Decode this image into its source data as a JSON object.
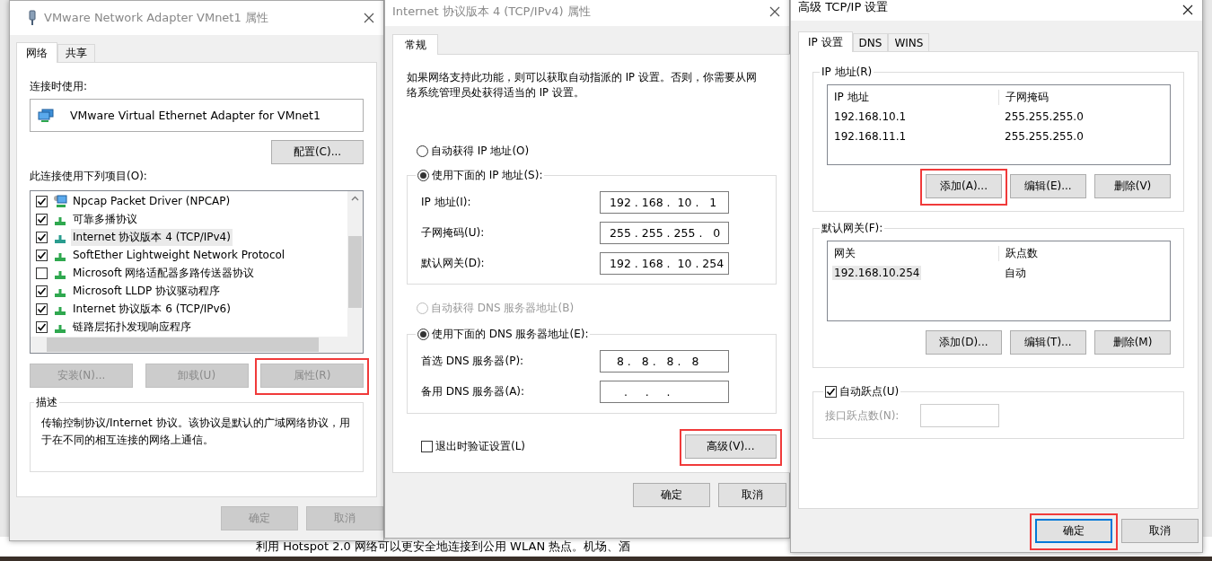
{
  "adapter_window": {
    "title": "VMware Network Adapter VMnet1 属性",
    "tabs": [
      {
        "label": "网络",
        "selected": true
      },
      {
        "label": "共享",
        "selected": false
      }
    ],
    "connect_label": "连接时使用:",
    "adapter_name": "VMware Virtual Ethernet Adapter for VMnet1",
    "configure_button": "配置(C)...",
    "items_label": "此连接使用下列项目(O):",
    "items": [
      {
        "kind": "driver",
        "label": "Npcap Packet Driver (NPCAP)",
        "checked": true,
        "selected": false
      },
      {
        "kind": "protocol",
        "label": "可靠多播协议",
        "checked": true,
        "selected": false
      },
      {
        "kind": "protocol",
        "label": "Internet 协议版本 4 (TCP/IPv4)",
        "checked": true,
        "selected": true
      },
      {
        "kind": "protocol",
        "label": "SoftEther Lightweight Network Protocol",
        "checked": true,
        "selected": false
      },
      {
        "kind": "protocol",
        "label": "Microsoft 网络适配器多路传送器协议",
        "checked": false,
        "selected": false
      },
      {
        "kind": "protocol",
        "label": "Microsoft LLDP 协议驱动程序",
        "checked": true,
        "selected": false
      },
      {
        "kind": "protocol",
        "label": "Internet 协议版本 6 (TCP/IPv6)",
        "checked": true,
        "selected": false
      },
      {
        "kind": "protocol",
        "label": "链路层拓扑发现响应程序",
        "checked": true,
        "selected": false
      }
    ],
    "buttons": [
      {
        "label": "安装(N)...",
        "disabled": true,
        "highlighted": false
      },
      {
        "label": "卸载(U)",
        "disabled": true,
        "highlighted": false
      },
      {
        "label": "属性(R)",
        "disabled": true,
        "highlighted": true
      }
    ],
    "description_title": "描述",
    "description": "传输控制协议/Internet 协议。该协议是默认的广域网络协议，用于在不同的相互连接的网络上通信。",
    "footer_buttons": [
      {
        "label": "确定",
        "disabled": true,
        "highlighted": false
      },
      {
        "label": "取消",
        "disabled": true,
        "highlighted": false
      }
    ]
  },
  "ipv4_window": {
    "title": "Internet 协议版本 4 (TCP/IPv4) 属性",
    "tabs": [
      {
        "label": "常规",
        "selected": true
      }
    ],
    "intro": "如果网络支持此功能，则可以获取自动指派的 IP 设置。否则，你需要从网络系统管理员处获得适当的 IP 设置。",
    "ip_mode": [
      {
        "label": "自动获得 IP 地址(O)",
        "selected": false,
        "disabled": false
      },
      {
        "label": "使用下面的 IP 地址(S):",
        "selected": true,
        "disabled": false
      }
    ],
    "ip_fields": [
      {
        "label": "IP 地址(I):",
        "value": "192 . 168 .  10 .   1"
      },
      {
        "label": "子网掩码(U):",
        "value": "255 . 255 . 255 .   0"
      },
      {
        "label": "默认网关(D):",
        "value": "192 . 168 .  10 . 254"
      }
    ],
    "dns_mode": [
      {
        "label": "自动获得 DNS 服务器地址(B)",
        "selected": false,
        "disabled": true
      },
      {
        "label": "使用下面的 DNS 服务器地址(E):",
        "selected": true,
        "disabled": false
      }
    ],
    "dns_fields": [
      {
        "label": "首选 DNS 服务器(P):",
        "value": "  8 .   8 .   8 .   8"
      },
      {
        "label": "备用 DNS 服务器(A):",
        "value": "    .     .     ."
      }
    ],
    "validate": {
      "label": "退出时验证设置(L)",
      "checked": false
    },
    "advanced_button": {
      "label": "高级(V)...",
      "disabled": false,
      "highlighted": true
    },
    "footer_buttons": [
      {
        "label": "确定",
        "disabled": false,
        "highlighted": false
      },
      {
        "label": "取消",
        "disabled": false,
        "highlighted": false
      }
    ]
  },
  "advanced_window": {
    "title": "高级 TCP/IP 设置",
    "tabs": [
      {
        "label": "IP 设置",
        "selected": true
      },
      {
        "label": "DNS",
        "selected": false
      },
      {
        "label": "WINS",
        "selected": false
      }
    ],
    "groups": [
      {
        "title": "IP 地址(R)",
        "columns": [
          "IP 地址",
          "子网掩码"
        ],
        "rows": [
          {
            "cells": [
              "192.168.10.1",
              "255.255.255.0"
            ],
            "selected": false
          },
          {
            "cells": [
              "192.168.11.1",
              "255.255.255.0"
            ],
            "selected": false
          }
        ],
        "buttons": [
          {
            "label": "添加(A)...",
            "disabled": false,
            "highlighted": true
          },
          {
            "label": "编辑(E)...",
            "disabled": false,
            "highlighted": false
          },
          {
            "label": "删除(V)",
            "disabled": false,
            "highlighted": false
          }
        ]
      },
      {
        "title": "默认网关(F):",
        "columns": [
          "网关",
          "跃点数"
        ],
        "rows": [
          {
            "cells": [
              "192.168.10.254",
              "自动"
            ],
            "selected": true
          }
        ],
        "buttons": [
          {
            "label": "添加(D)...",
            "disabled": false,
            "highlighted": false
          },
          {
            "label": "编辑(T)...",
            "disabled": false,
            "highlighted": false
          },
          {
            "label": "删除(M)",
            "disabled": false,
            "highlighted": false
          }
        ]
      }
    ],
    "auto_metric": {
      "label": "自动跃点(U)",
      "checked": true
    },
    "metric_field": {
      "label": "接口跃点数(N):",
      "disabled": true
    },
    "footer_buttons": [
      {
        "label": "确定",
        "disabled": false,
        "highlighted": true,
        "focused": true
      },
      {
        "label": "取消",
        "disabled": false,
        "highlighted": false,
        "focused": false
      }
    ]
  },
  "background_text": "利用 Hotspot 2.0 网络可以更安全地连接到公用 WLAN 热点。机场、酒"
}
